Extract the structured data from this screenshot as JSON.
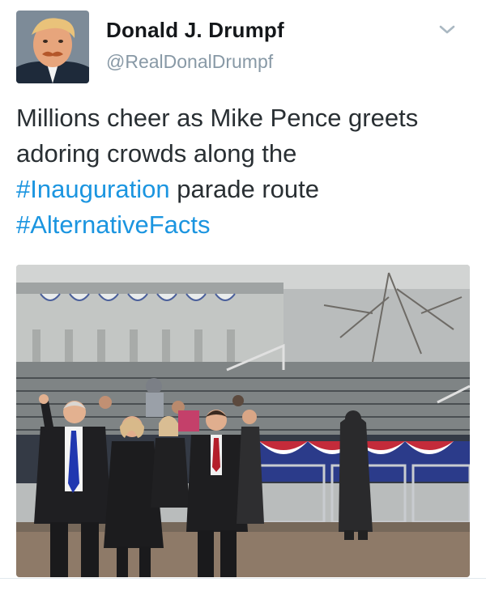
{
  "tweet": {
    "display_name": "Donald J. Drumpf",
    "handle": "@RealDonalDrumpf",
    "text_line1": "Millions cheer as Mike Pence greets",
    "text_line2": "adoring crowds along the",
    "hashtag_inauguration": "#Inauguration",
    "text_line3_rest": " parade route",
    "hashtag_alternative": "#AlternativeFacts"
  },
  "icons": {
    "menu": "chevron-down-icon"
  },
  "colors": {
    "hashtag": "#1b95e0",
    "name": "#14171a",
    "handle": "#8899a6",
    "text": "#292f33"
  }
}
